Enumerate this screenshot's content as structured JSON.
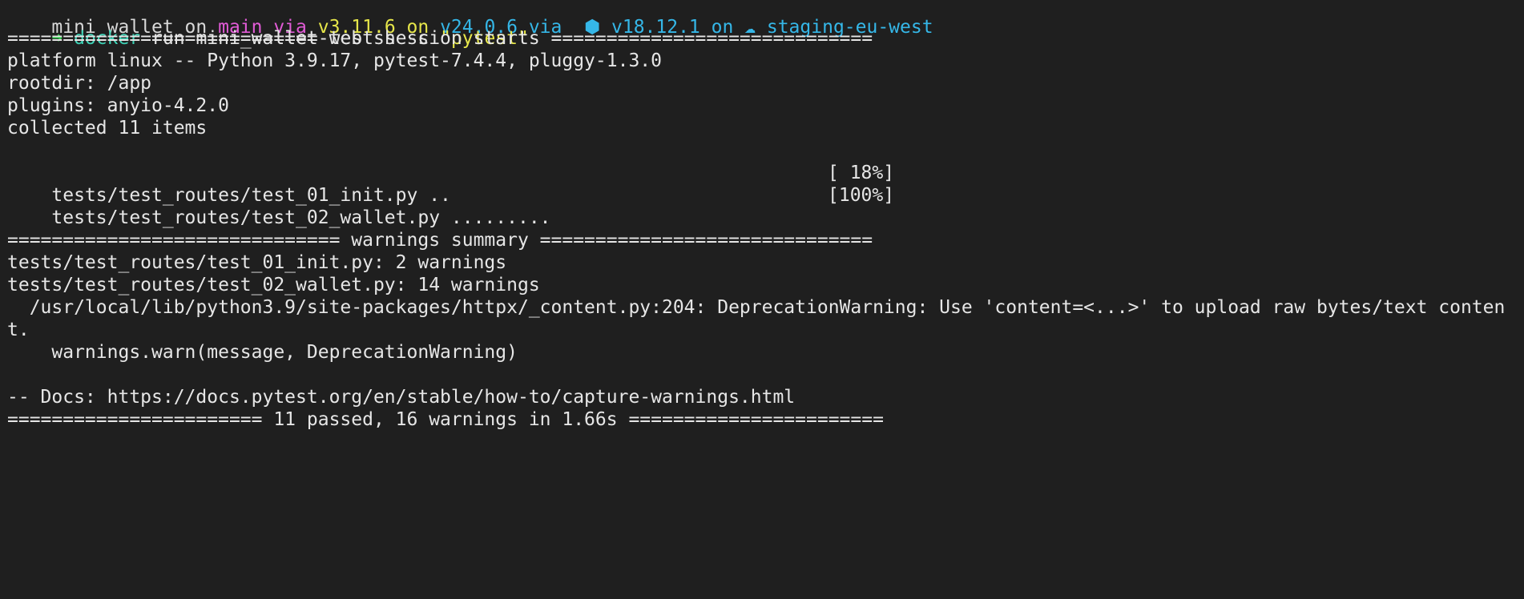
{
  "prompt": {
    "partial_top": {
      "seg1": "mini_wallet on ",
      "seg2": "main via ",
      "seg3": "v3.11.6 on ",
      "seg4": "v24.0.6 via  ⬢ v18.12.1 on ☁ staging-eu-west"
    },
    "arrow": "➜",
    "command": "docker",
    "args": "run mini_wallet-web sh -c ",
    "quoted": "\"pytest\""
  },
  "output": {
    "header": "============================ test session starts =============================",
    "platform": "platform linux -- Python 3.9.17, pytest-7.4.4, pluggy-1.3.0",
    "rootdir": "rootdir: /app",
    "plugins": "plugins: anyio-4.2.0",
    "collected": "collected 11 items",
    "test_lines": [
      {
        "path": "tests/test_routes/test_01_init.py ..",
        "progress": "[ 18%]"
      },
      {
        "path": "tests/test_routes/test_02_wallet.py .........",
        "progress": "[100%]"
      }
    ],
    "warnings_header": "============================== warnings summary ==============================",
    "warning_files": [
      "tests/test_routes/test_01_init.py: 2 warnings",
      "tests/test_routes/test_02_wallet.py: 14 warnings"
    ],
    "warning_detail_1": "  /usr/local/lib/python3.9/site-packages/httpx/_content.py:204: DeprecationWarning: Use 'content=<...>' to upload raw bytes/text conten",
    "warning_detail_2": "t.",
    "warning_detail_3": "    warnings.warn(message, DeprecationWarning)",
    "docs": "-- Docs: https://docs.pytest.org/en/stable/how-to/capture-warnings.html",
    "summary": "======================= 11 passed, 16 warnings in 1.66s ======================="
  },
  "colors": {
    "background": "#1f1f1f",
    "text": "#e6e6e6",
    "arrow": "#2ec44a",
    "command": "#3ed1b5",
    "string": "#e8e84a"
  }
}
